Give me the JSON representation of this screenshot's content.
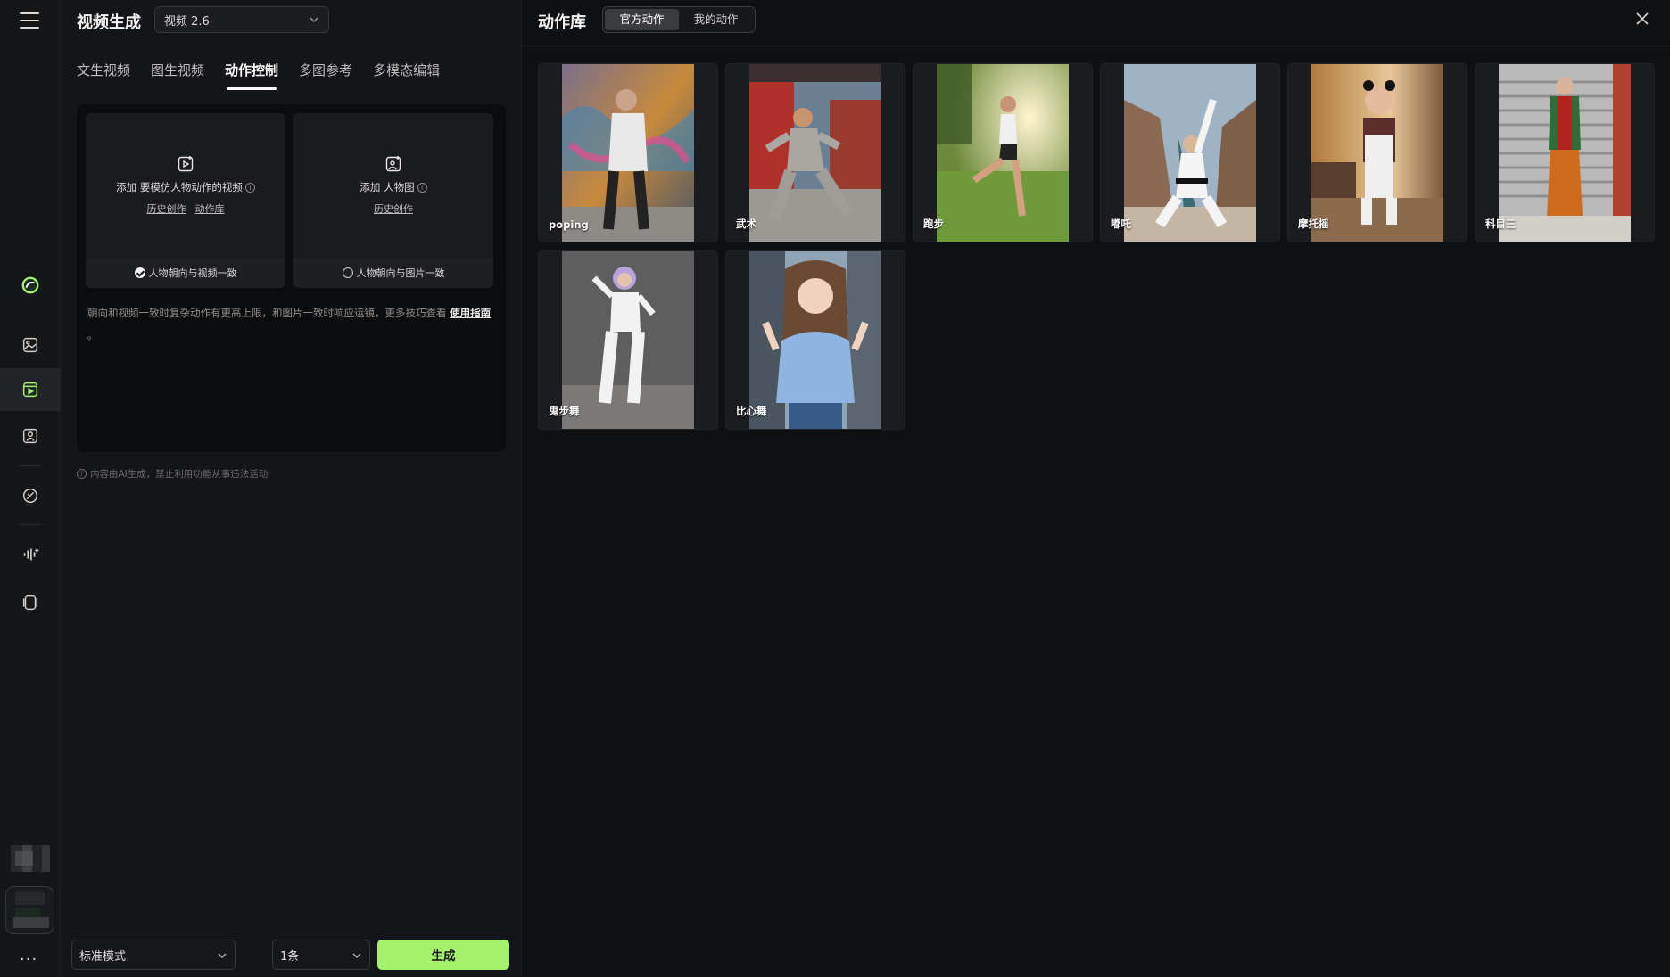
{
  "app": {
    "title": "视频生成",
    "model": "视频 2.6"
  },
  "tabs": [
    {
      "label": "文生视频",
      "active": false
    },
    {
      "label": "图生视频",
      "active": false
    },
    {
      "label": "动作控制",
      "active": true
    },
    {
      "label": "多图参考",
      "active": false
    },
    {
      "label": "多模态编辑",
      "active": false
    }
  ],
  "uploads": {
    "video": {
      "label": "添加 要模仿人物动作的视频",
      "links": [
        "历史创作",
        "动作库"
      ],
      "orientation": "人物朝向与视频一致",
      "checked": true
    },
    "image": {
      "label": "添加 人物图",
      "links": [
        "历史创作"
      ],
      "orientation": "人物朝向与图片一致",
      "checked": false
    }
  },
  "hint": {
    "text": "朝向和视频一致时复杂动作有更高上限，和图片一致时响应运镜，更多技巧查看",
    "link": "使用指南",
    "suffix": "。"
  },
  "disclaimer": "内容由AI生成，禁止利用功能从事违法活动",
  "bottom": {
    "mode": "标准模式",
    "count": "1条",
    "generate": "生成"
  },
  "library": {
    "title": "动作库",
    "segments": [
      {
        "label": "官方动作",
        "active": true
      },
      {
        "label": "我的动作",
        "active": false
      }
    ],
    "items": [
      {
        "name": "poping"
      },
      {
        "name": "武术"
      },
      {
        "name": "跑步"
      },
      {
        "name": "嘟吒"
      },
      {
        "name": "摩托摇"
      },
      {
        "name": "科目三"
      },
      {
        "name": "鬼步舞"
      },
      {
        "name": "比心舞"
      }
    ]
  },
  "colors": {
    "accent": "#a3f36d",
    "background": "#0f1012",
    "panel": "#141518"
  }
}
